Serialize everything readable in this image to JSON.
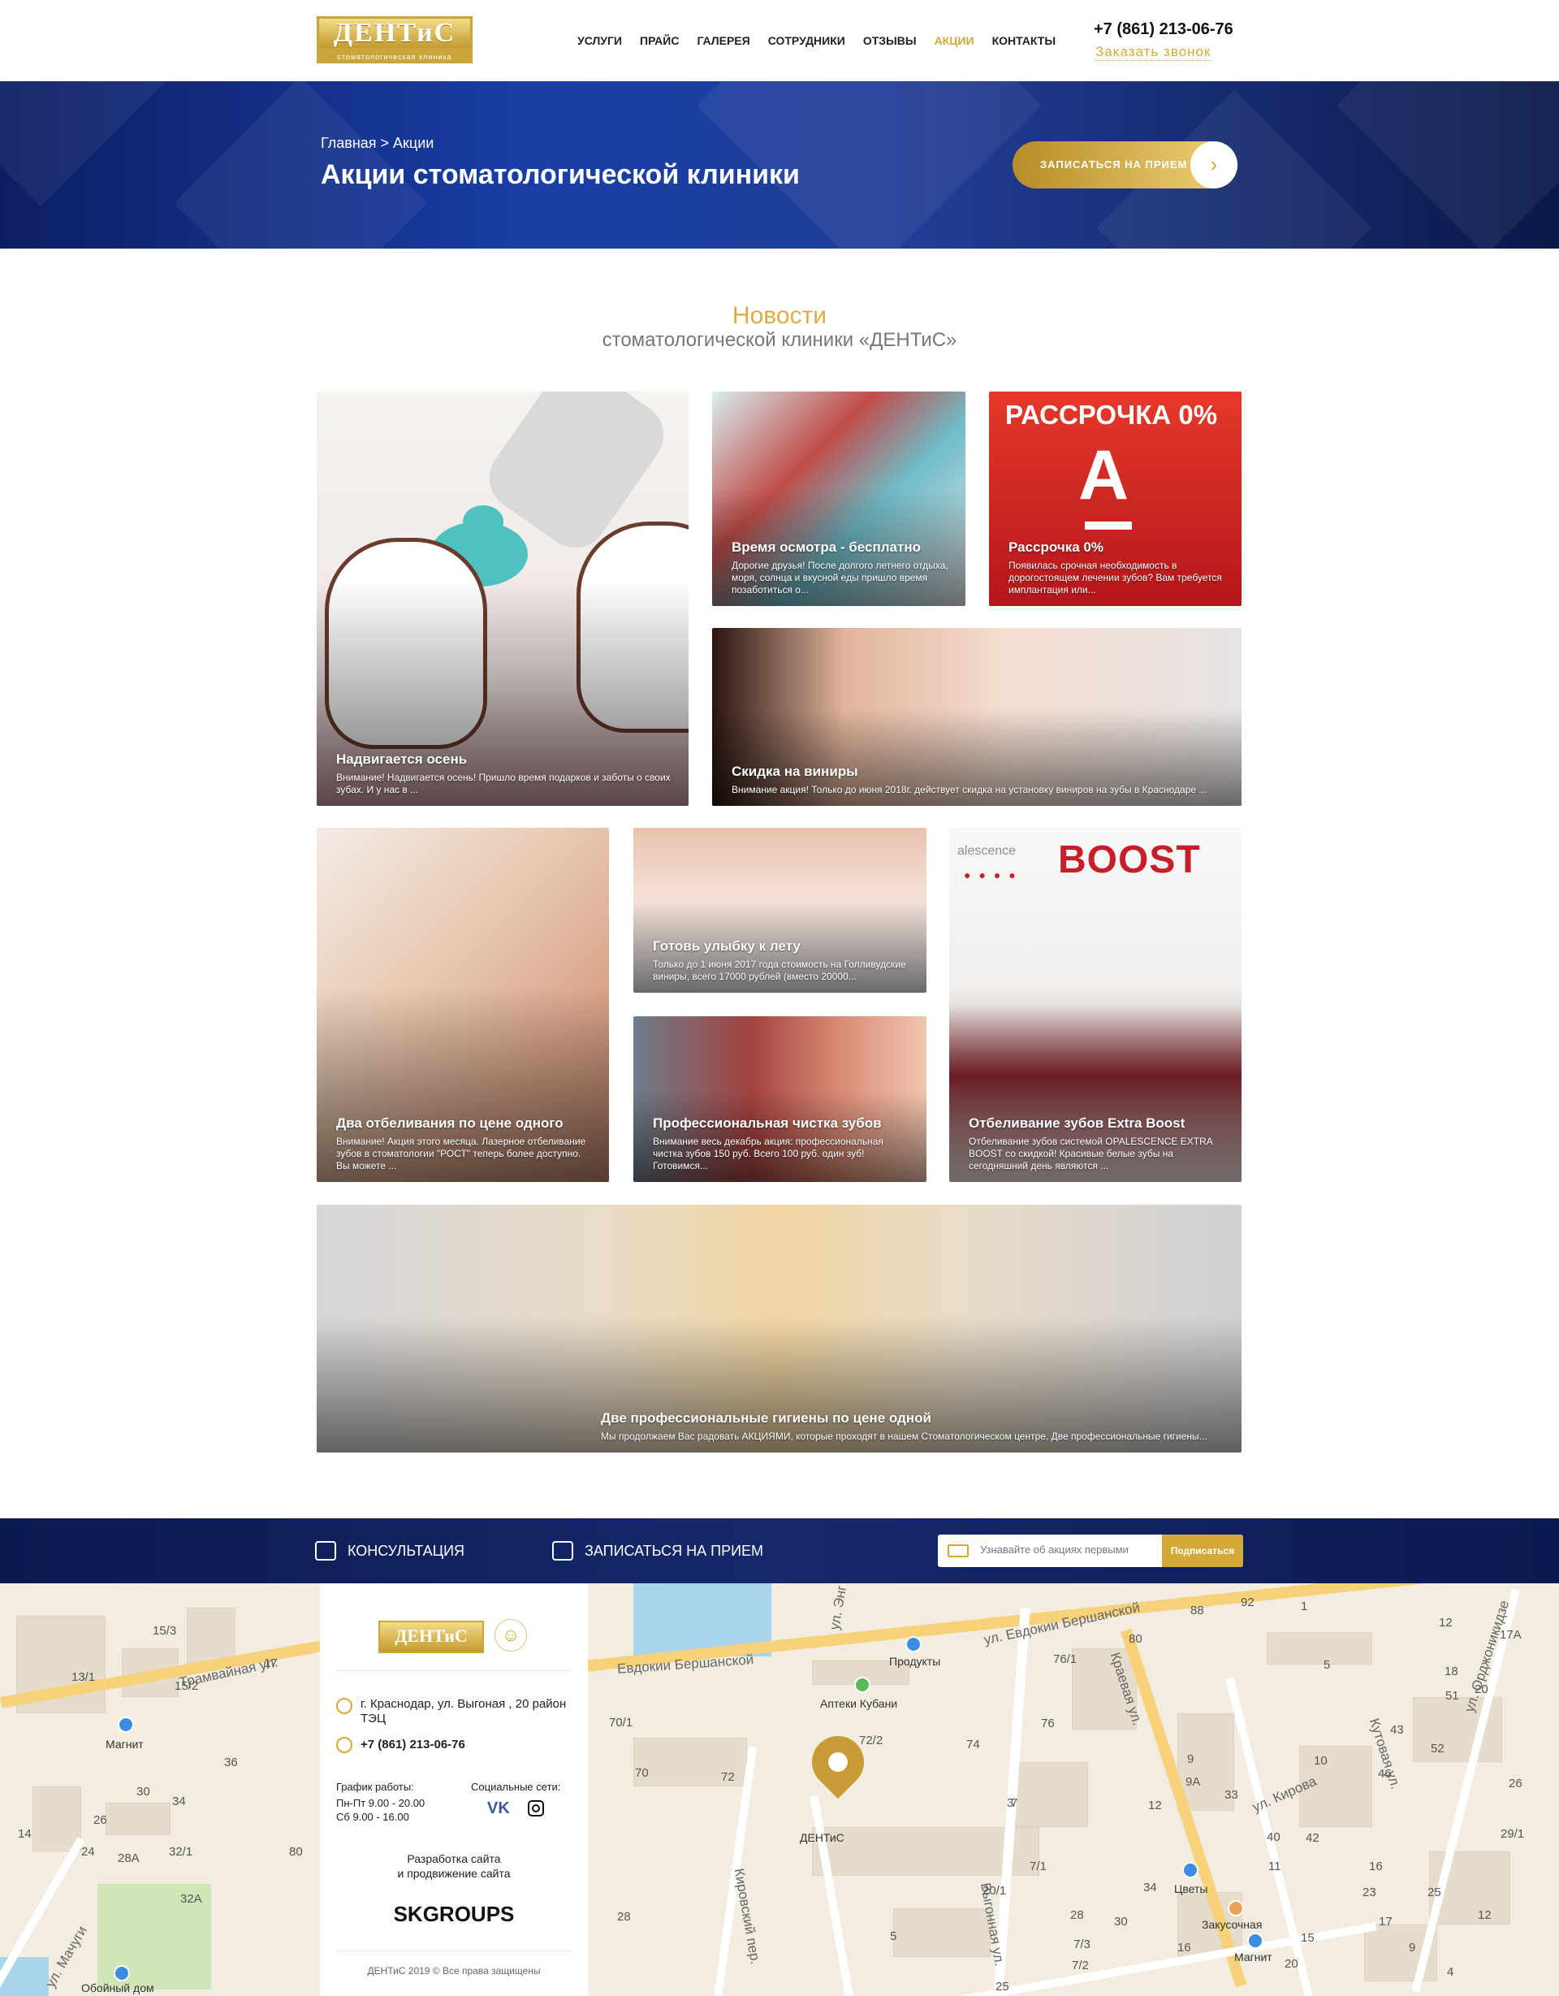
{
  "header": {
    "logo_main": "ДЕНТиС",
    "logo_sub": "стоматологическая клиника",
    "nav": [
      "УСЛУГИ",
      "ПРАЙС",
      "ГАЛЕРЕЯ",
      "СОТРУДНИКИ",
      "ОТЗЫВЫ",
      "АКЦИИ",
      "КОНТАКТЫ"
    ],
    "active_nav": "АКЦИИ",
    "phone": "+7 (861) 213-06-76",
    "callback": "Заказать звонок"
  },
  "hero": {
    "breadcrumb": "Главная > Акции",
    "title": "Акции стоматологической клиники",
    "cta_label": "ЗАПИСАТЬСЯ НА ПРИЕМ",
    "cta_icon": "chevron-right-icon"
  },
  "news": {
    "title": "Новости",
    "subtitle": "стоматологической клиники «ДЕНТиС»",
    "cards": [
      {
        "title": "Надвигается осень",
        "desc": "Внимание! Надвигается осень! Пришло время подарков и заботы о своих зубах. И у нас в ..."
      },
      {
        "title": "Время осмотра - бесплатно",
        "desc": "Дорогие друзья! После долгого летнего отдыха, моря, солнца и вкусной еды пришло время позаботиться о..."
      },
      {
        "title": "Рассрочка 0%",
        "desc": "Появилась срочная необходимость в дорогостоящем лечении зубов? Вам требуется имплантация или...",
        "banner": "РАССРОЧКА 0%",
        "brand_letter": "А"
      },
      {
        "title": "Скидка на виниры",
        "desc": "Внимание акция! Только до июня 2018г. действует скидка на установку виниров на зубы в Краснодаре ..."
      },
      {
        "title": "Два отбеливания по цене одного",
        "desc": "Внимание! Акция этого месяца. Лазерное отбеливание зубов в стоматологии \"РОСТ\" теперь более доступно. Вы можете ..."
      },
      {
        "title": "Готовь улыбку к лету",
        "desc": "Только до 1 июня 2017 года стоимость на Голливудские виниры, всего 17000 рублей (вместо 20000..."
      },
      {
        "title": "Профессиональная чистка зубов",
        "desc": "Внимание весь декабрь акция: профессиональная чистка зубов 150 руб. Всего 100 руб. один зуб! Готовимся..."
      },
      {
        "title": "Отбеливание зубов Extra Boost",
        "desc": "Отбеливание зубов системой OPALESCENCE EXTRA BOOST со скидкой! Красивые белые зубы на сегодняшний день являются ...",
        "banner": "BOOST",
        "banner_pre": "alescence"
      },
      {
        "title": "Две профессиональные гигиены по цене одной",
        "desc": "Мы продолжаем Вас радовать АКЦИЯМИ, которые проходят в нашем Стоматологическом центре. Две профессиональные гигиены..."
      }
    ]
  },
  "footer_bar": {
    "consult": "КОНСУЛЬТАЦИЯ",
    "appointment": "ЗАПИСАТЬСЯ НА ПРИЕМ",
    "subscribe_placeholder": "Узнавайте об акциях первыми",
    "subscribe_button": "Подписаться"
  },
  "contact": {
    "logo": "ДЕНТиС",
    "address": "г. Краснодар, ул. Выгоная , 20 район ТЭЦ",
    "phone": "+7 (861) 213-06-76",
    "hours_label": "График работы:",
    "hours_weekdays": "Пн-Пт  9.00 - 20.00",
    "hours_sat": "Сб  9.00 - 16.00",
    "social_label": "Социальные сети:",
    "vk": "VK",
    "dev_line1": "Разработка сайта",
    "dev_line2": "и продвижение сайта",
    "developer": "SKGROUPS",
    "copyright": "ДЕНТиС 2019 © Все права защищены"
  },
  "map": {
    "streets": [
      "Трамвайная ул.",
      "ул. Евдокии Бершанской",
      "Евдокии Бершанской",
      "Краевая ул.",
      "ул. Кирова",
      "Кутовая ул.",
      "ул. Орджоникидзе",
      "Выгонная ул.",
      "Кировский пер.",
      "ул. Мачуги",
      "ул. Энг"
    ],
    "pois": [
      "Магнит",
      "Продукты",
      "Аптеки Кубани",
      "ДЕНТиС",
      "Цветы",
      "Закусочная",
      "Магнит",
      "Обойный дом"
    ],
    "numbers": [
      "15/3",
      "17",
      "13/1",
      "15/2",
      "36",
      "30",
      "34",
      "26",
      "24",
      "28А",
      "32/1",
      "80",
      "32А",
      "70/1",
      "70",
      "72",
      "72/2",
      "74",
      "76",
      "76/1",
      "80",
      "88",
      "92",
      "12",
      "17А",
      "5",
      "18",
      "51",
      "20",
      "43",
      "52",
      "9",
      "9А",
      "33",
      "46",
      "10",
      "40",
      "42",
      "12",
      "16",
      "11",
      "23",
      "25",
      "29/1",
      "26",
      "7",
      "20/1",
      "7/1",
      "34",
      "30",
      "28",
      "25",
      "5",
      "7/3",
      "7/2",
      "3",
      "16",
      "20",
      "15",
      "17",
      "12",
      "9",
      "4",
      "28",
      "14",
      "1"
    ],
    "accent_color": "#c99b37"
  }
}
